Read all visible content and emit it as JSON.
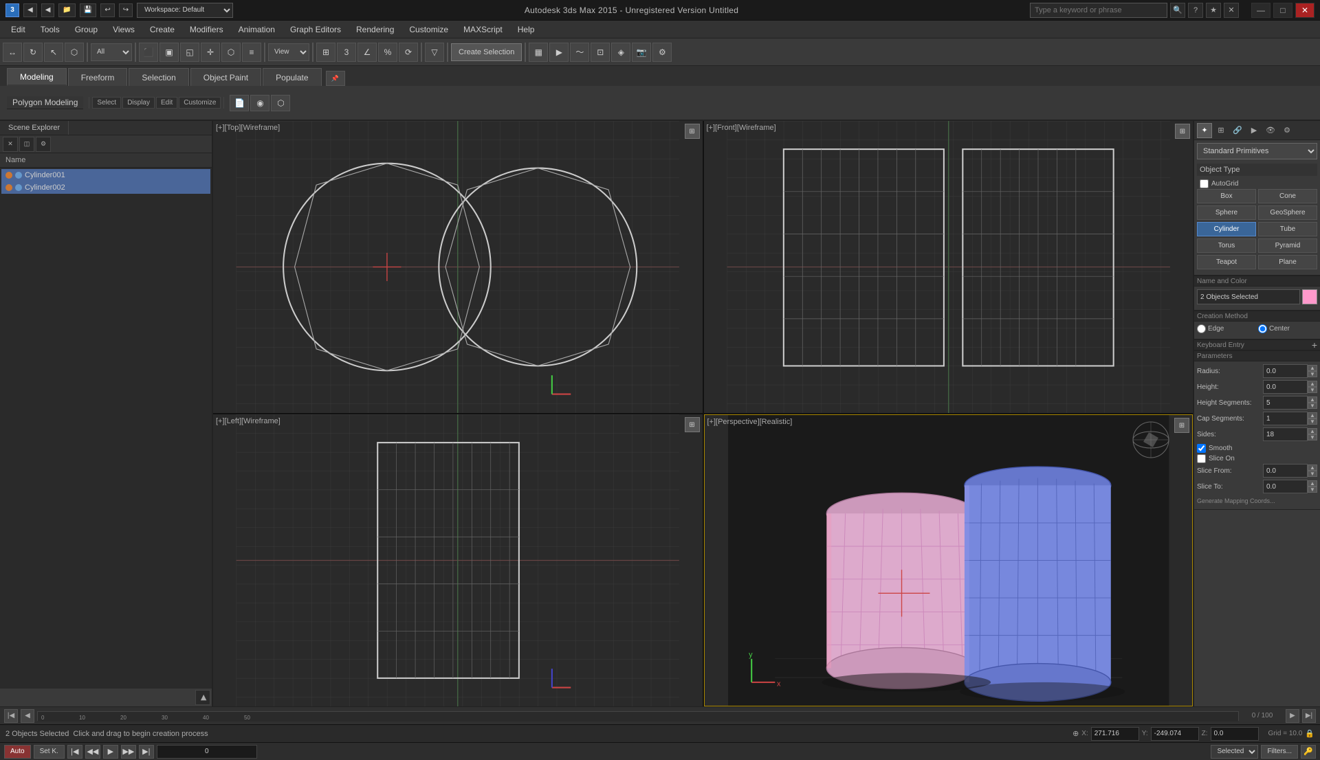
{
  "titleBar": {
    "logo": "3",
    "workspaceLabel": "Workspace: Default",
    "title": "Autodesk 3ds Max  2015  -  Unregistered Version    Untitled",
    "searchPlaceholder": "Type a keyword or phrase",
    "windowButtons": [
      "—",
      "□",
      "✕"
    ]
  },
  "menuBar": {
    "items": [
      "Edit",
      "Tools",
      "Group",
      "Views",
      "Create",
      "Modifiers",
      "Animation",
      "Graph Editors",
      "Rendering",
      "Customize",
      "MAXScript",
      "Help"
    ]
  },
  "toolbar": {
    "createSelection": "Create Selection",
    "viewDropdown": "View",
    "filterDropdown": "All"
  },
  "ribbonTabs": {
    "tabs": [
      "Modeling",
      "Freeform",
      "Selection",
      "Object Paint",
      "Populate"
    ],
    "activeTab": "Modeling"
  },
  "polygonLabel": "Polygon Modeling",
  "ribbonPanelTabs": [
    "Select",
    "Display",
    "Edit",
    "Customize"
  ],
  "sceneTree": {
    "header": "Name",
    "items": [
      {
        "name": "Cylinder001",
        "selected": true
      },
      {
        "name": "Cylinder002",
        "selected": true
      }
    ]
  },
  "viewports": {
    "topLeft": "[+][Top][Wireframe]",
    "topRight": "[+][Front][Wireframe]",
    "bottomLeft": "[+][Left][Wireframe]",
    "bottomRight": "[+][Perspective][Realistic]"
  },
  "rightPanel": {
    "primitives": {
      "dropdownValue": "Standard Primitives",
      "objectTypeLabel": "Object Type",
      "autoGridLabel": "AutoGrid",
      "buttons": [
        "Box",
        "Cone",
        "Sphere",
        "GeoSphere",
        "Cylinder",
        "Tube",
        "Torus",
        "Pyramid",
        "Teapot",
        "Plane"
      ],
      "activeButton": "Cylinder"
    },
    "nameAndColor": {
      "sectionLabel": "Name and Color",
      "inputValue": "2 Objects Selected",
      "swatchColor": "#ff99cc"
    },
    "creationMethod": {
      "sectionLabel": "Creation Method",
      "options": [
        "Edge",
        "Center"
      ]
    },
    "keyboardEntry": {
      "sectionLabel": "Keyboard Entry",
      "addBtnLabel": "+"
    },
    "parameters": {
      "sectionLabel": "Parameters",
      "fields": [
        {
          "label": "Radius:",
          "value": "0.0"
        },
        {
          "label": "Height:",
          "value": "0.0"
        },
        {
          "label": "Height Segments:",
          "value": "5"
        },
        {
          "label": "Cap Segments:",
          "value": "1"
        },
        {
          "label": "Sides:",
          "value": "18"
        }
      ],
      "checkboxes": [
        {
          "label": "Smooth",
          "checked": true
        },
        {
          "label": "Slice On",
          "checked": false
        }
      ],
      "sliceFields": [
        {
          "label": "Slice From:",
          "value": "0.0"
        },
        {
          "label": "Slice To:",
          "value": "0.0"
        }
      ],
      "generateLabel": "Generate Mapping Coords..."
    }
  },
  "navBar": {
    "timeValue": "0 / 100"
  },
  "statusBar": {
    "selectedCount": "2 Objects Selected",
    "message": "Click and drag to begin creation process",
    "coords": {
      "x": {
        "label": "X:",
        "value": "271.716"
      },
      "y": {
        "label": "Y:",
        "value": "-249.074"
      },
      "z": {
        "label": "Z:",
        "value": "0.0"
      }
    },
    "grid": "Grid = 10.0"
  },
  "bottomBar": {
    "autoLabel": "Auto",
    "selectedLabel": "Selected",
    "setKLabel": "Set K.",
    "filtersLabel": "Filters..."
  }
}
